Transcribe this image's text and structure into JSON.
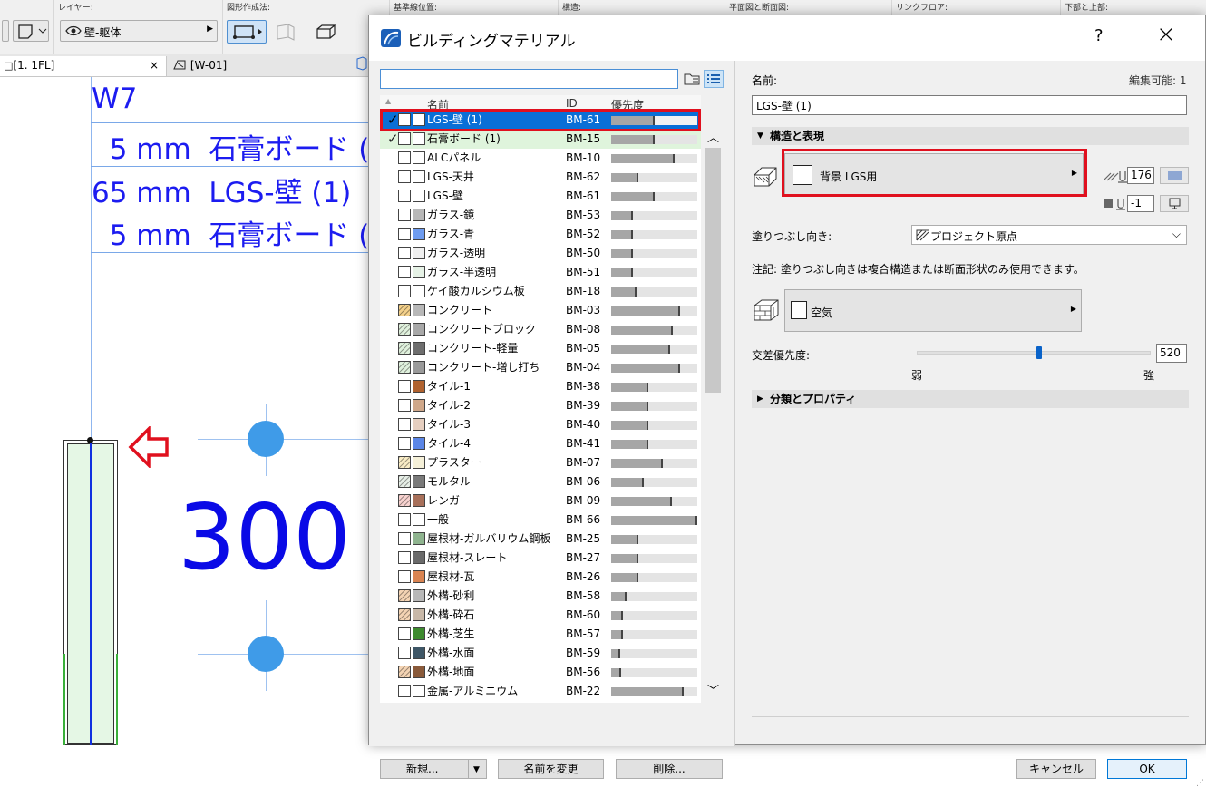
{
  "toolbar": {
    "layer_label": "レイヤー:",
    "layer_value": "壁-躯体",
    "geometry_label": "図形作成法:",
    "ref_line_label": "基準線位置:",
    "structure_label": "構造:",
    "plan_section_label": "平面図と断面図:",
    "link_floor_label": "リンクフロア:",
    "top_bottom_label": "下部と上部:"
  },
  "tabs": [
    {
      "label": "[1. 1FL]"
    },
    {
      "label": "[W-01]"
    }
  ],
  "canvas": {
    "wall_name": "W7",
    "layers": [
      "  5 mm  石膏ボード (",
      "65 mm  LGS-壁 (1)",
      "  5 mm  石膏ボード ("
    ],
    "dimension": "300"
  },
  "dialog": {
    "title": "ビルディングマテリアル",
    "help": "?",
    "close": "×",
    "search_value": "",
    "columns": {
      "name": "名前",
      "id": "ID",
      "priority": "優先度"
    },
    "rows": [
      {
        "name": "LGS-壁 (1)",
        "id": "BM-61",
        "priority": 0.5,
        "color2": "#ffffff",
        "fill": "#ffffff",
        "checked": true,
        "selected": true
      },
      {
        "name": "石膏ボード (1)",
        "id": "BM-15",
        "priority": 0.5,
        "color2": "#ffffff",
        "fill": "#ffffff",
        "checked": true,
        "used": true
      },
      {
        "name": "ALCパネル",
        "id": "BM-10",
        "priority": 0.74,
        "color2": "#ffffff",
        "fill": "#ffffff"
      },
      {
        "name": "LGS-天井",
        "id": "BM-62",
        "priority": 0.32,
        "color2": "#ffffff",
        "fill": "#ffffff"
      },
      {
        "name": "LGS-壁",
        "id": "BM-61",
        "priority": 0.5,
        "color2": "#ffffff",
        "fill": "#ffffff"
      },
      {
        "name": "ガラス-鏡",
        "id": "BM-53",
        "priority": 0.25,
        "color2": "#b8b8b8",
        "fill": "#ffffff"
      },
      {
        "name": "ガラス-青",
        "id": "BM-52",
        "priority": 0.25,
        "color2": "#6e9cf0",
        "fill": "#ffffff"
      },
      {
        "name": "ガラス-透明",
        "id": "BM-50",
        "priority": 0.25,
        "color2": "#f0f0f0",
        "fill": "#ffffff"
      },
      {
        "name": "ガラス-半透明",
        "id": "BM-51",
        "priority": 0.25,
        "color2": "#e6f2e6",
        "fill": "#ffffff"
      },
      {
        "name": "ケイ酸カルシウム板",
        "id": "BM-18",
        "priority": 0.29,
        "color2": "#ffffff",
        "fill": "#ffffff"
      },
      {
        "name": "コンクリート",
        "id": "BM-03",
        "priority": 0.8,
        "color2": "#b8b8b8",
        "fill": "#f3d08a"
      },
      {
        "name": "コンクリートブロック",
        "id": "BM-08",
        "priority": 0.72,
        "color2": "#a8a8a8",
        "fill": "#dff0dc"
      },
      {
        "name": "コンクリート-軽量",
        "id": "BM-05",
        "priority": 0.68,
        "color2": "#6e6e6e",
        "fill": "#dff0dc"
      },
      {
        "name": "コンクリート-増し打ち",
        "id": "BM-04",
        "priority": 0.8,
        "color2": "#9a9a9a",
        "fill": "#dff0dc"
      },
      {
        "name": "タイル-1",
        "id": "BM-38",
        "priority": 0.43,
        "color2": "#b0622f",
        "fill": "#ffffff"
      },
      {
        "name": "タイル-2",
        "id": "BM-39",
        "priority": 0.43,
        "color2": "#cfa789",
        "fill": "#ffffff"
      },
      {
        "name": "タイル-3",
        "id": "BM-40",
        "priority": 0.43,
        "color2": "#e6cfc0",
        "fill": "#ffffff"
      },
      {
        "name": "タイル-4",
        "id": "BM-41",
        "priority": 0.43,
        "color2": "#5b86e6",
        "fill": "#ffffff"
      },
      {
        "name": "プラスター",
        "id": "BM-07",
        "priority": 0.6,
        "color2": "#f5f0d8",
        "fill": "#f8ebc4"
      },
      {
        "name": "モルタル",
        "id": "BM-06",
        "priority": 0.38,
        "color2": "#7a7a7a",
        "fill": "#e6eee6"
      },
      {
        "name": "レンガ",
        "id": "BM-09",
        "priority": 0.7,
        "color2": "#a8705a",
        "fill": "#f7d2cf"
      },
      {
        "name": "一般",
        "id": "BM-66",
        "priority": 1.0,
        "color2": "#ffffff",
        "fill": "#ffffff"
      },
      {
        "name": "屋根材-ガルバリウム鋼板",
        "id": "BM-25",
        "priority": 0.32,
        "color2": "#8fb48f",
        "fill": "#ffffff"
      },
      {
        "name": "屋根材-スレート",
        "id": "BM-27",
        "priority": 0.32,
        "color2": "#6a6a6a",
        "fill": "#ffffff"
      },
      {
        "name": "屋根材-瓦",
        "id": "BM-26",
        "priority": 0.32,
        "color2": "#d98452",
        "fill": "#ffffff"
      },
      {
        "name": "外構-砂利",
        "id": "BM-58",
        "priority": 0.18,
        "color2": "#b8b8b8",
        "fill": "#f3d3b3"
      },
      {
        "name": "外構-砕石",
        "id": "BM-60",
        "priority": 0.14,
        "color2": "#c8b8a8",
        "fill": "#f3d3b3"
      },
      {
        "name": "外構-芝生",
        "id": "BM-57",
        "priority": 0.14,
        "color2": "#3d8a2e",
        "fill": "#ffffff"
      },
      {
        "name": "外構-水面",
        "id": "BM-59",
        "priority": 0.1,
        "color2": "#3e5666",
        "fill": "#ffffff"
      },
      {
        "name": "外構-地面",
        "id": "BM-56",
        "priority": 0.12,
        "color2": "#8a5a3a",
        "fill": "#f3d3b3"
      },
      {
        "name": "金属-アルミニウム",
        "id": "BM-22",
        "priority": 0.84,
        "color2": "#ffffff",
        "fill": "#ffffff"
      }
    ],
    "buttons": {
      "new": "新規...",
      "rename": "名前を変更",
      "delete": "削除..."
    },
    "right": {
      "name_label": "名前:",
      "editable": "編集可能: 1",
      "name_value": "LGS-壁 (1)",
      "section_structure": "構造と表現",
      "cut_fill_label": "背景 LGS用",
      "pen_value_1": "176",
      "pen_value_2": "-1",
      "fill_orientation_label": "塗りつぶし向き:",
      "fill_orientation_value": "プロジェクト原点",
      "note": "注記: 塗りつぶし向きは複合構造または断面形状のみ使用できます。",
      "surface_label": "空気",
      "intersection_label": "交差優先度:",
      "intersection_value": "520",
      "intersection_fraction": 0.52,
      "weak": "弱",
      "strong": "強",
      "section_classification": "分類とプロパティ",
      "cancel": "キャンセル",
      "ok": "OK"
    }
  }
}
